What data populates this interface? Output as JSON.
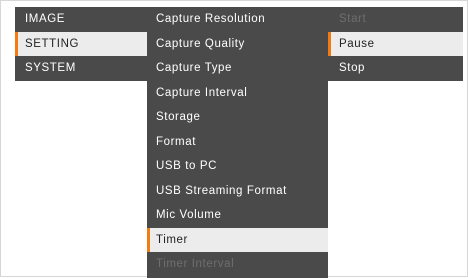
{
  "main_menu": {
    "items": [
      {
        "label": "IMAGE"
      },
      {
        "label": "SETTING"
      },
      {
        "label": "SYSTEM"
      }
    ]
  },
  "setting_menu": {
    "items": [
      {
        "label": "Capture Resolution"
      },
      {
        "label": "Capture Quality"
      },
      {
        "label": "Capture Type"
      },
      {
        "label": "Capture Interval"
      },
      {
        "label": "Storage"
      },
      {
        "label": "Format"
      },
      {
        "label": "USB to PC"
      },
      {
        "label": "USB Streaming Format"
      },
      {
        "label": "Mic Volume"
      },
      {
        "label": "Timer"
      },
      {
        "label": "Timer Interval"
      }
    ]
  },
  "timer_options": {
    "items": [
      {
        "label": "Start"
      },
      {
        "label": "Pause"
      },
      {
        "label": "Stop"
      }
    ]
  },
  "colors": {
    "menu_background": "#4a4a4a",
    "selected_background": "#ececec",
    "accent": "#f07c12",
    "disabled_text": "#6e6e6e"
  }
}
